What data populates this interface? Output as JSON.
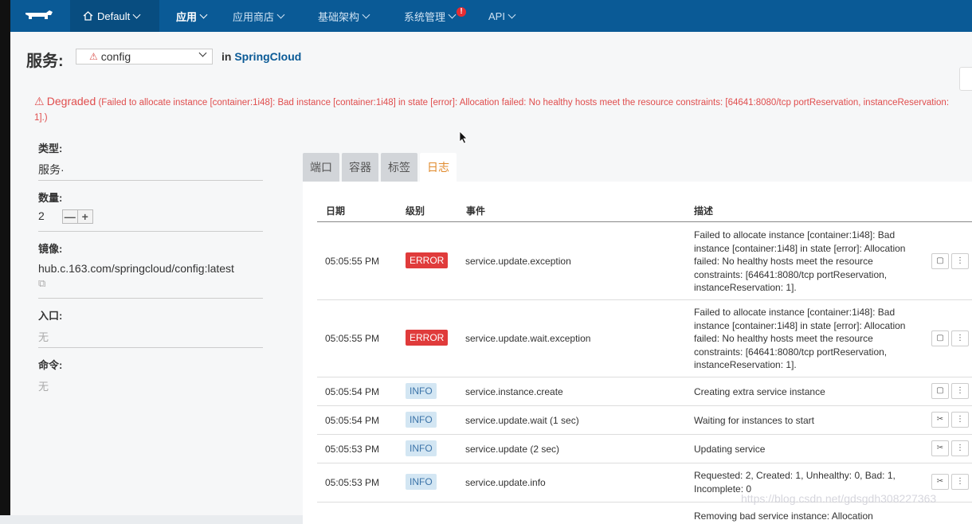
{
  "nav": {
    "environment": "Default",
    "items": [
      "应用",
      "应用商店",
      "基础架构",
      "系统管理",
      "API"
    ],
    "alert_badge": "!"
  },
  "service": {
    "label": "服务:",
    "name": "config",
    "in_label": "in",
    "stack": "SpringCloud"
  },
  "status": {
    "state": "Degraded",
    "message": "(Failed to allocate instance [container:1i48]: Bad instance [container:1i48] in state [error]: Allocation failed: No healthy hosts meet the resource constraints: [64641:8080/tcp portReservation, instanceReservation: 1].)"
  },
  "details": {
    "type_label": "类型:",
    "type_value": "服务·",
    "scale_label": "数量:",
    "scale_value": "2",
    "scale_minus": "—",
    "scale_plus": "+",
    "image_label": "镜像:",
    "image_value": "hub.c.163.com/springcloud/config:latest",
    "entrypoint_label": "入口:",
    "entrypoint_value": "无",
    "command_label": "命令:",
    "command_value": "无"
  },
  "tabs": [
    "端口",
    "容器",
    "标签",
    "日志"
  ],
  "log_table": {
    "headers": [
      "日期",
      "级别",
      "事件",
      "描述"
    ],
    "rows": [
      {
        "time": "05:05:55 PM",
        "level": "ERROR",
        "event": "service.update.exception",
        "description": "Failed to allocate instance [container:1i48]: Bad instance [container:1i48] in state [error]: Allocation failed: No healthy hosts meet the resource constraints: [64641:8080/tcp portReservation, instanceReservation: 1]."
      },
      {
        "time": "05:05:55 PM",
        "level": "ERROR",
        "event": "service.update.wait.exception",
        "description": "Failed to allocate instance [container:1i48]: Bad instance [container:1i48] in state [error]: Allocation failed: No healthy hosts meet the resource constraints: [64641:8080/tcp portReservation, instanceReservation: 1]."
      },
      {
        "time": "05:05:54 PM",
        "level": "INFO",
        "event": "service.instance.create",
        "description": "Creating extra service instance"
      },
      {
        "time": "05:05:54 PM",
        "level": "INFO",
        "event": "service.update.wait (1 sec)",
        "description": "Waiting for instances to start"
      },
      {
        "time": "05:05:53 PM",
        "level": "INFO",
        "event": "service.update (2 sec)",
        "description": "Updating service"
      },
      {
        "time": "05:05:53 PM",
        "level": "INFO",
        "event": "service.update.info",
        "description": "Requested: 2, Created: 1, Unhealthy: 0, Bad: 1, Incomplete: 0"
      },
      {
        "time": "",
        "level": "",
        "event": "",
        "description": "Removing bad service instance: Allocation"
      }
    ]
  },
  "watermark": "https://blog.csdn.net/gdsgdh308227363",
  "colors": {
    "topbar": "#0a5a96",
    "error": "#e03b3b",
    "info_bg": "#d3e6f3",
    "active_tab": "#e08a2c"
  }
}
